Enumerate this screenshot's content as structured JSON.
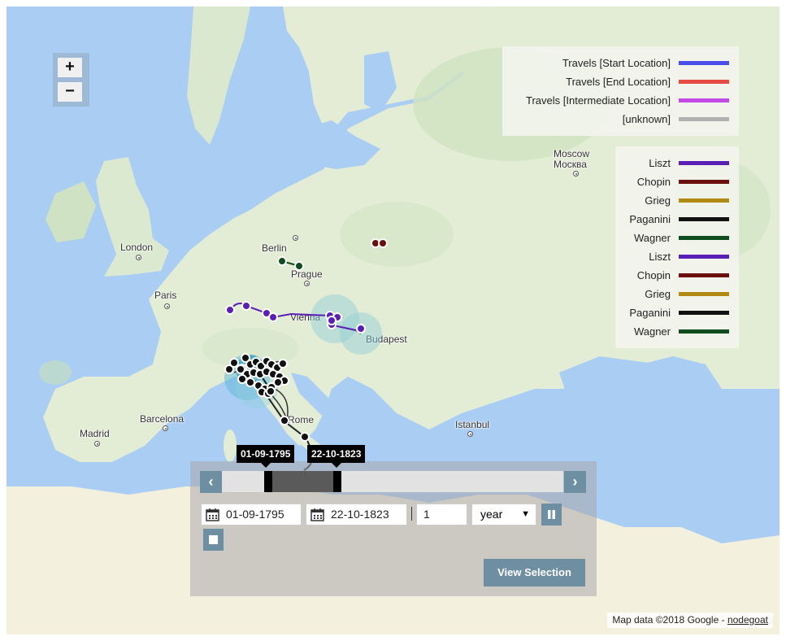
{
  "zoom": {
    "in_label": "+",
    "out_label": "−"
  },
  "cities": {
    "moscow_latin": "Moscow",
    "moscow_cyrillic": "Москва",
    "berlin": "Berlin",
    "prague": "Prague",
    "london": "London",
    "paris": "Paris",
    "vienna": "Vienna",
    "budapest": "Budapest",
    "rome": "Rome",
    "barcelona": "Barcelona",
    "madrid": "Madrid",
    "istanbul": "Istanbul"
  },
  "legend_travels": [
    {
      "label": "Travels [Start Location]",
      "color": "#4a4ee8"
    },
    {
      "label": "Travels [End Location]",
      "color": "#e84a44"
    },
    {
      "label": "Travels [Intermediate Location]",
      "color": "#c44ae8"
    },
    {
      "label": "[unknown]",
      "color": "#b0b0b0"
    }
  ],
  "legend_composers": [
    {
      "label": "Liszt",
      "color": "#5a1fb5"
    },
    {
      "label": "Chopin",
      "color": "#6b0f0f"
    },
    {
      "label": "Grieg",
      "color": "#b08a12"
    },
    {
      "label": "Paganini",
      "color": "#111111"
    },
    {
      "label": "Wagner",
      "color": "#0f4d1f"
    },
    {
      "label": "Liszt",
      "color": "#5a1fb5"
    },
    {
      "label": "Chopin",
      "color": "#6b0f0f"
    },
    {
      "label": "Grieg",
      "color": "#b08a12"
    },
    {
      "label": "Paganini",
      "color": "#111111"
    },
    {
      "label": "Wagner",
      "color": "#0f4d1f"
    }
  ],
  "timeline": {
    "start_tip": "01-09-1795",
    "end_tip": "22-10-1823",
    "start_date": "01-09-1795",
    "end_date": "22-10-1823",
    "step": "1",
    "unit": "year",
    "prev_icon": "chevron-left-icon",
    "next_icon": "chevron-right-icon",
    "view_selection_label": "View Selection"
  },
  "attribution": {
    "text": "Map data ©2018 Google - ",
    "link": "nodegoat"
  }
}
